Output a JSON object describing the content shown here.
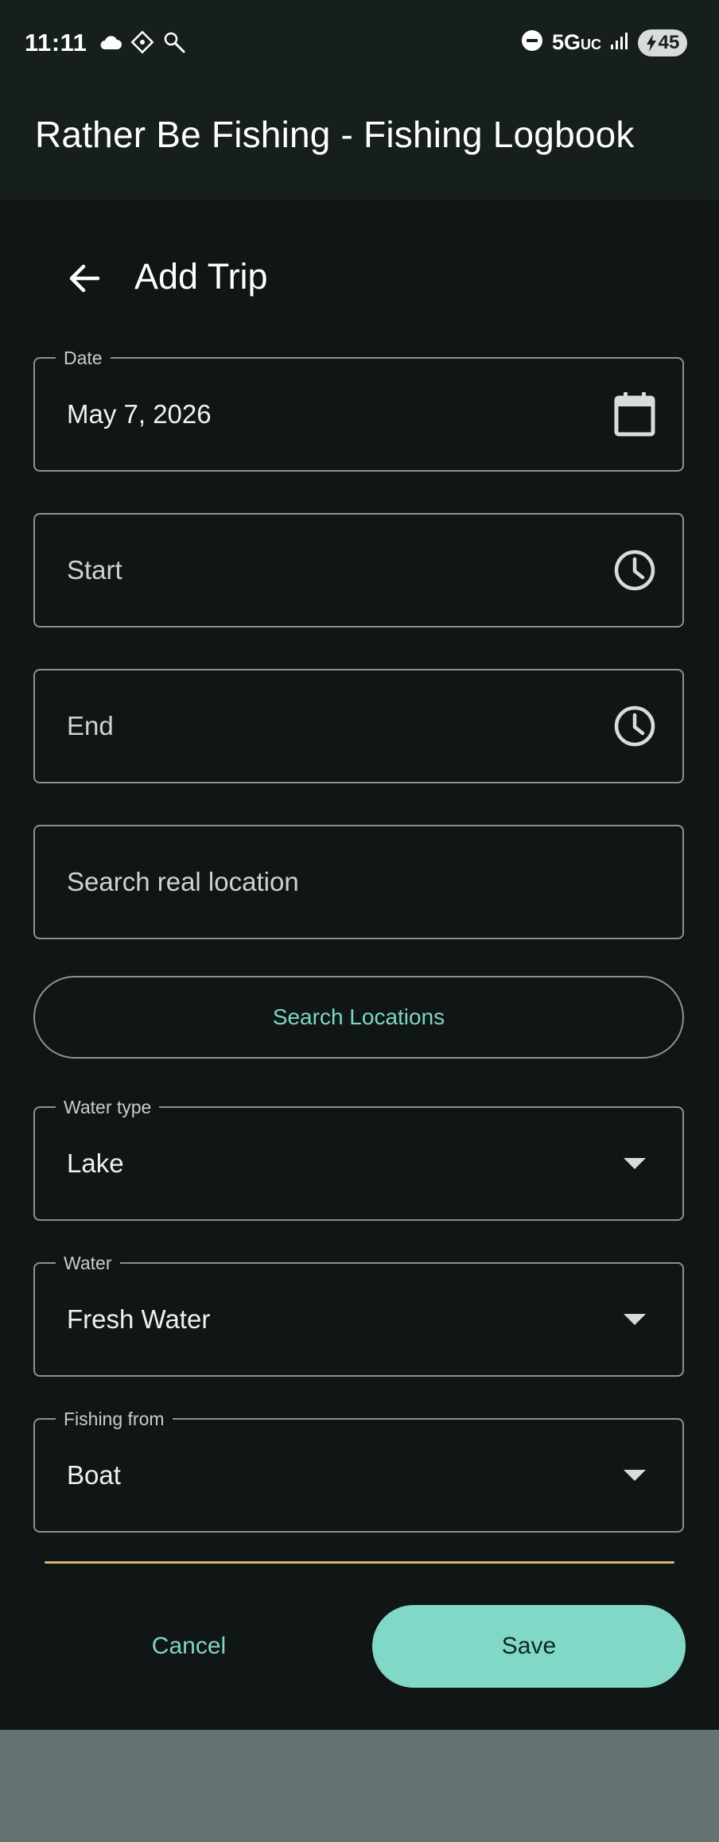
{
  "status_bar": {
    "time": "11:11",
    "left_icons": [
      "cloud-icon",
      "vpn-badge-icon",
      "flashlight-icon"
    ],
    "network": "5G",
    "network_suffix": "UC",
    "battery_level": "45"
  },
  "app_bar": {
    "title": "Rather Be Fishing - Fishing Logbook"
  },
  "page": {
    "title": "Add Trip"
  },
  "form": {
    "date": {
      "label": "Date",
      "value": "May 7, 2026"
    },
    "start": {
      "placeholder": "Start"
    },
    "end": {
      "placeholder": "End"
    },
    "location": {
      "placeholder": "Search real location"
    },
    "search_button": "Search Locations",
    "water_type": {
      "label": "Water type",
      "value": "Lake"
    },
    "water": {
      "label": "Water",
      "value": "Fresh Water"
    },
    "fishing_from": {
      "label": "Fishing from",
      "value": "Boat"
    }
  },
  "actions": {
    "cancel": "Cancel",
    "save": "Save"
  },
  "colors": {
    "background": "#101515",
    "app_bar": "#171e1e",
    "accent": "#82d8c6",
    "accent_text": "#7fd6c3",
    "outline": "#8b9392",
    "divider": "#d9b56e",
    "nav_area": "#667373"
  }
}
